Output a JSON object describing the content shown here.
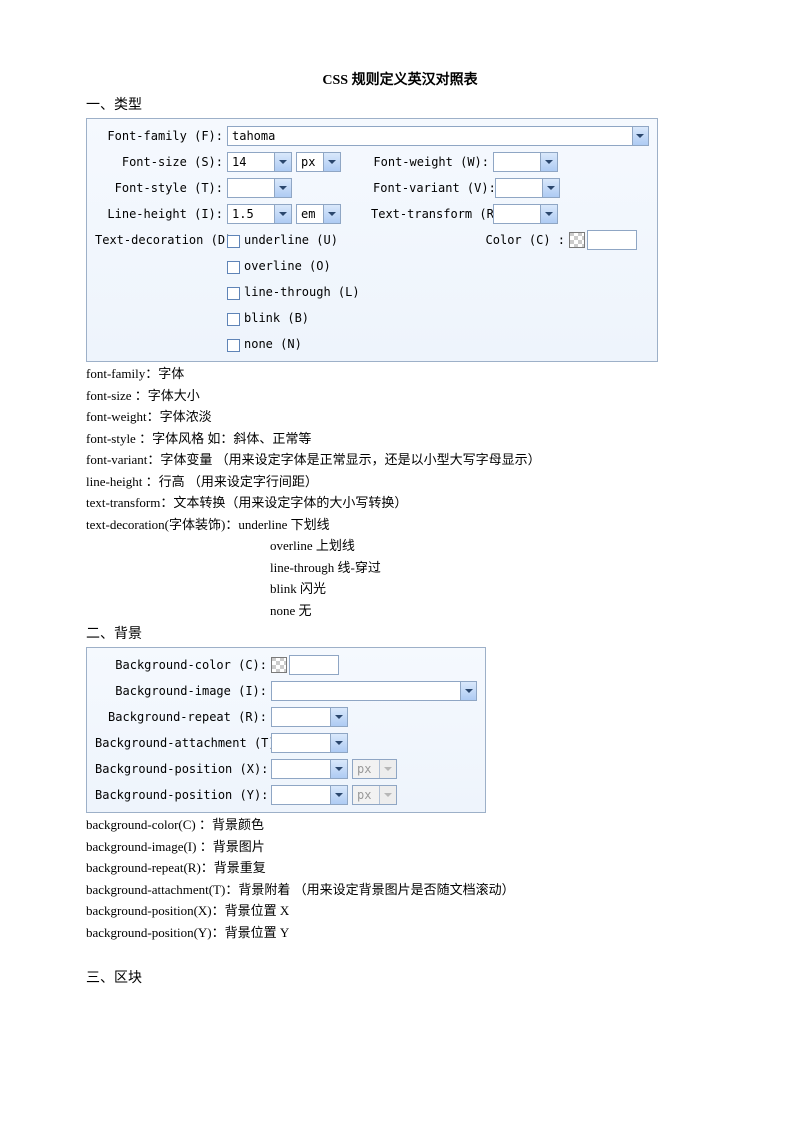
{
  "doc_title": "CSS 规则定义英汉对照表",
  "section1": "一、类型",
  "section2": "二、背景",
  "section3": "三、区块",
  "panel1": {
    "font_family_lbl": "Font-family (F):",
    "font_family_val": "tahoma",
    "font_size_lbl": "Font-size (S):",
    "font_size_val": "14",
    "font_size_unit": "px",
    "font_weight_lbl": "Font-weight (W):",
    "font_style_lbl": "Font-style (T):",
    "font_variant_lbl": "Font-variant (V):",
    "line_height_lbl": "Line-height (I):",
    "line_height_val": "1.5",
    "line_height_unit": "em",
    "text_transform_lbl": "Text-transform (R):",
    "text_decoration_lbl": "Text-decoration (D):",
    "deco_underline": "underline (U)",
    "deco_overline": "overline (O)",
    "deco_linethrough": "line-through (L)",
    "deco_blink": "blink (B)",
    "deco_none": "none (N)",
    "color_lbl": "Color (C)  :"
  },
  "notes1": [
    "font-family：字体",
    "font-size ：字体大小",
    "font-weight：字体浓淡",
    "font-style ：字体风格   如：斜体、正常等",
    "font-variant：字体变量   （用来设定字体是正常显示，还是以小型大写字母显示）",
    "line-height  ：行高   （用来设定字行间距）",
    "text-transform：文本转换（用来设定字体的大小写转换）",
    "text-decoration(字体装饰)：underline 下划线"
  ],
  "notes1_indented": [
    "overline 上划线",
    "line-through    线-穿过",
    "blink     闪光",
    "none      无"
  ],
  "panel2": {
    "bg_color_lbl": "Background-color (C):",
    "bg_image_lbl": "Background-image (I):",
    "bg_repeat_lbl": "Background-repeat (R):",
    "bg_attachment_lbl": "Background-attachment (T):",
    "bg_pos_x_lbl": "Background-position (X):",
    "bg_pos_y_lbl": "Background-position (Y):",
    "unit_px": "px"
  },
  "notes2": [
    "background-color(C)  ：背景颜色",
    "background-image(I)  ：背景图片",
    "background-repeat(R)：背景重复",
    "background-attachment(T)：背景附着   （用来设定背景图片是否随文档滚动）",
    "background-position(X)：背景位置 X",
    "background-position(Y)：背景位置 Y"
  ]
}
